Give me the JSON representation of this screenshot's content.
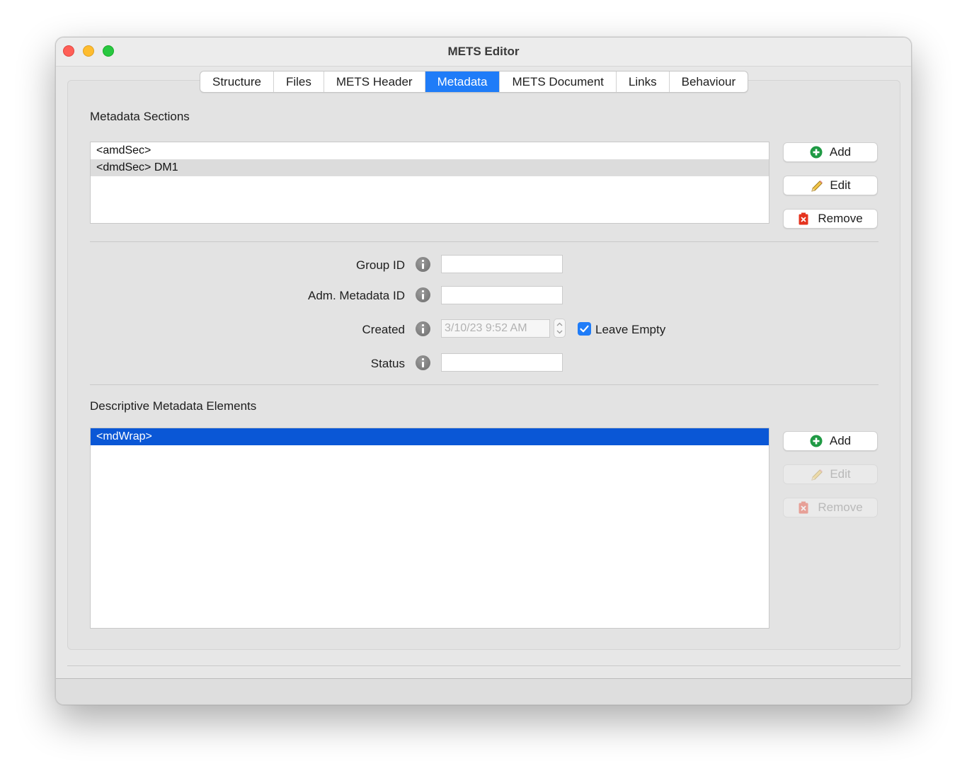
{
  "window": {
    "title": "METS Editor"
  },
  "tabs": [
    {
      "label": "Structure"
    },
    {
      "label": "Files"
    },
    {
      "label": "METS Header"
    },
    {
      "label": "Metadata",
      "active": true
    },
    {
      "label": "METS Document"
    },
    {
      "label": "Links"
    },
    {
      "label": "Behaviour"
    }
  ],
  "metadata_sections": {
    "label": "Metadata Sections",
    "items": [
      {
        "text": "<amdSec>"
      },
      {
        "text": "<dmdSec> DM1",
        "selected": true
      }
    ],
    "buttons": {
      "add": "Add",
      "edit": "Edit",
      "remove": "Remove"
    }
  },
  "form": {
    "group_id": {
      "label": "Group ID",
      "value": ""
    },
    "adm_metadata_id": {
      "label": "Adm. Metadata ID",
      "value": ""
    },
    "created": {
      "label": "Created",
      "value": "3/10/23 9:52 AM",
      "leave_empty_label": "Leave Empty",
      "leave_empty_checked": true
    },
    "status": {
      "label": "Status",
      "value": ""
    }
  },
  "descriptive_elements": {
    "label": "Descriptive Metadata Elements",
    "items": [
      {
        "text": "<mdWrap>",
        "selected": true
      }
    ],
    "buttons": {
      "add": "Add",
      "edit": "Edit",
      "remove": "Remove"
    }
  },
  "colors": {
    "accent": "#1f7cf8",
    "selection": "#0a57d6",
    "add_icon": "#1f9a44",
    "remove_icon": "#e5331e"
  }
}
